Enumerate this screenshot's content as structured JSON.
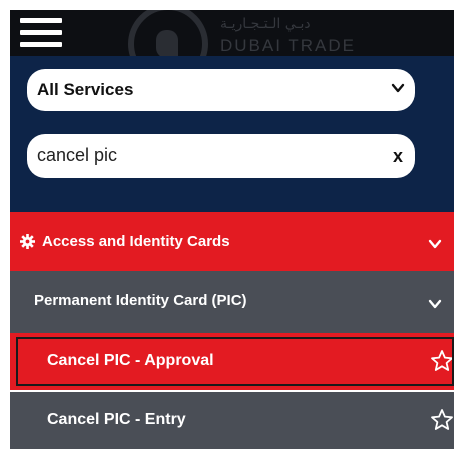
{
  "header": {
    "logo_arabic": "دبـي الـتـجـاريـة",
    "logo_latin": "DUBAI TRADE",
    "menu_icon": "hamburger-menu-icon"
  },
  "filters": {
    "service_select": {
      "selected": "All Services",
      "icon": "chevron-down-icon"
    },
    "search": {
      "value": "cancel pic",
      "clear_label": "x"
    }
  },
  "results": {
    "category": {
      "label": "Access and Identity Cards",
      "icon": "gear-icon",
      "expanded": true
    },
    "subcategory": {
      "label": "Permanent Identity Card (PIC)",
      "expanded": true
    },
    "items": [
      {
        "label": "Cancel PIC - Approval",
        "selected": true,
        "favorite_icon": "star-outline-icon"
      },
      {
        "label": "Cancel PIC - Entry",
        "selected": false,
        "favorite_icon": "star-outline-icon"
      }
    ]
  },
  "colors": {
    "topbar": "#0d0f13",
    "panel": "#0d2448",
    "accent_red": "#e31b22",
    "row_gray": "#4a4e56"
  }
}
